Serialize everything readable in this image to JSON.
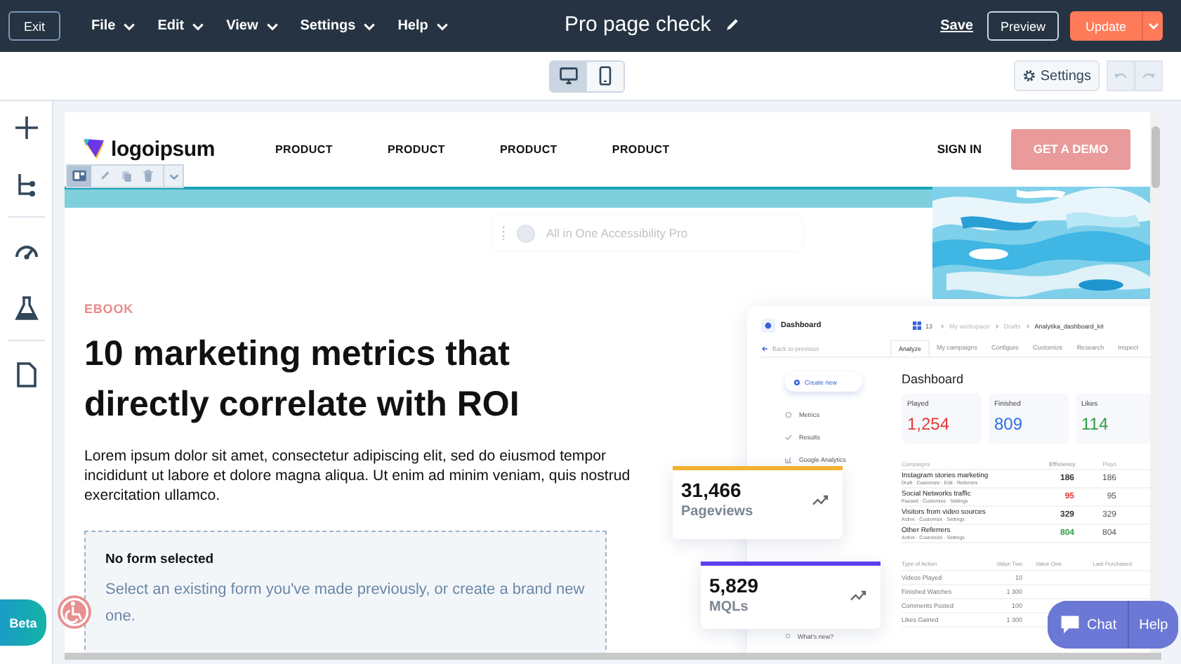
{
  "topbar": {
    "exit": "Exit",
    "menus": [
      {
        "label": "File"
      },
      {
        "label": "Edit"
      },
      {
        "label": "View"
      },
      {
        "label": "Settings"
      },
      {
        "label": "Help"
      }
    ],
    "title": "Pro page check",
    "save": "Save",
    "preview": "Preview",
    "update": "Update"
  },
  "toolbar": {
    "devices": [
      {
        "kind": "desktop",
        "selected": true
      },
      {
        "kind": "mobile",
        "selected": false
      }
    ],
    "settings": "Settings"
  },
  "rail": [
    [
      {
        "kind": "add"
      },
      {
        "kind": "tree"
      }
    ],
    [
      {
        "kind": "gauge"
      },
      {
        "kind": "flask"
      }
    ],
    [
      {
        "kind": "page"
      }
    ]
  ],
  "page": {
    "nav": {
      "logo": "logoipsum",
      "links": [
        "PRODUCT",
        "PRODUCT",
        "PRODUCT",
        "PRODUCT"
      ],
      "sign_in": "SIGN IN",
      "cta": "GET A DEMO"
    },
    "accessibility_widget": {
      "label": "All in One Accessibility Pro",
      "on": false
    },
    "hero": {
      "eyebrow": "EBOOK",
      "heading": "10 marketing metrics that directly correlate with ROI",
      "body": "Lorem ipsum dolor sit amet, consectetur adipiscing elit, sed do eiusmod tempor incididunt ut labore et dolore magna aliqua. Ut enim ad minim veniam, quis nostrud exercitation ullamco.",
      "form": {
        "title": "No form selected",
        "message": "Select an existing form you've made previously, or create a brand new one."
      }
    },
    "dashboard": {
      "title": "Dashboard",
      "count": "13",
      "breadcrumbs": [
        "My workspace",
        "Drafts",
        "Analytika_dashboard_kit"
      ],
      "back": "Back to previous",
      "tabs": [
        {
          "label": "Analyze",
          "selected": true
        },
        {
          "label": "My campaigns",
          "selected": false
        },
        {
          "label": "Configure",
          "selected": false
        },
        {
          "label": "Customize",
          "selected": false
        },
        {
          "label": "Research",
          "selected": false
        },
        {
          "label": "Inspect",
          "selected": false
        }
      ],
      "create": "Create new",
      "menu": [
        {
          "label": "Metrics",
          "kind": "circle"
        },
        {
          "label": "Results",
          "kind": "check"
        },
        {
          "label": "Google Analytics",
          "kind": "bars"
        }
      ],
      "menu_footer": "What's new?",
      "heading": "Dashboard",
      "stats": [
        {
          "label": "Played",
          "value": "1,254",
          "color": "#e53935"
        },
        {
          "label": "Finished",
          "value": "809",
          "color": "#2f6fe4"
        },
        {
          "label": "Likes",
          "value": "114",
          "color": "#2e9e44"
        }
      ],
      "campaigns": {
        "columns": [
          "Campaigns",
          "Efficiency",
          "Plays"
        ],
        "rows": [
          {
            "name": "Instagram stories marketing",
            "actions": "Draft · Customize · Edit · Referrers",
            "efficiency": "186",
            "plays": "186",
            "color": "#333333"
          },
          {
            "name": "Social Networks traffic",
            "actions": "Paused · Customize · Settings",
            "efficiency": "95",
            "plays": "95",
            "color": "#e53935"
          },
          {
            "name": "Visitors from video sources",
            "actions": "Active · Customize · Settings",
            "efficiency": "329",
            "plays": "329",
            "color": "#333333"
          },
          {
            "name": "Other Referrers",
            "actions": "Active · Customize · Settings",
            "efficiency": "804",
            "plays": "804",
            "color": "#2e9e44"
          }
        ]
      },
      "actions": {
        "columns": [
          "Type of Action",
          "Value Two",
          "Value One",
          "Last Purchased"
        ],
        "rows": [
          {
            "type": "Videos Played",
            "value_two": "10"
          },
          {
            "type": "Finished Watches",
            "value_two": "1 300"
          },
          {
            "type": "Comments Posted",
            "value_two": "100"
          },
          {
            "type": "Likes Gained",
            "value_two": "1 300"
          }
        ]
      }
    },
    "metric_cards": [
      {
        "value": "31,466",
        "label": "Pageviews",
        "color": "#f2b233"
      },
      {
        "value": "5,829",
        "label": "MQLs",
        "color": "#5b3ff0"
      }
    ]
  },
  "beta": "Beta",
  "chat": "Chat",
  "help": "Help"
}
